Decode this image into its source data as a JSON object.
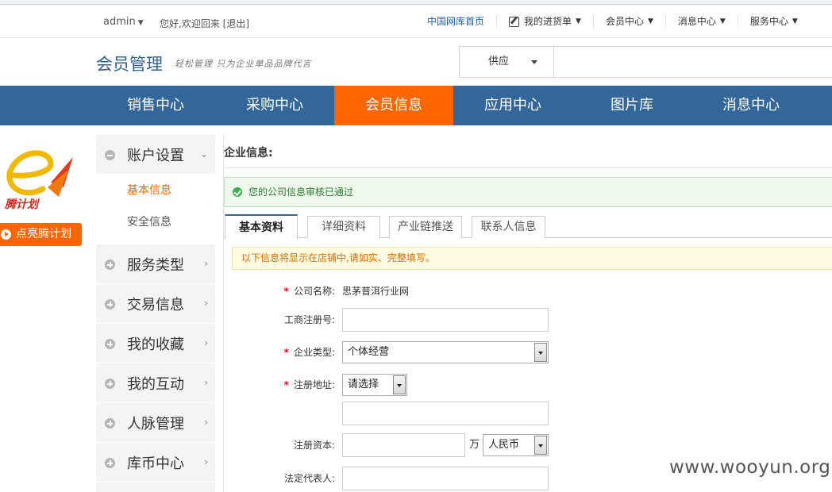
{
  "topbar": {
    "username": "admin",
    "greeting": "您好,欢迎回来",
    "logout": "[退出]",
    "nav": {
      "home": "中国网库首页",
      "purchase_orders": "我的进货单",
      "member_center": "会员中心",
      "message_center": "消息中心",
      "service_center": "服务中心"
    }
  },
  "header": {
    "title": "会员管理",
    "slogan": "轻松管理 只为企业单品品牌代言",
    "search_type": "供应",
    "search_placeholder": ""
  },
  "mainnav": {
    "tabs": [
      "销售中心",
      "采购中心",
      "会员信息",
      "应用中心",
      "图片库",
      "消息中心"
    ],
    "active": "会员信息"
  },
  "promo": {
    "logo_text": "腾计划",
    "button": "点亮腾计划"
  },
  "sidebar": {
    "account": "账户设置",
    "account_subs": [
      "基本信息",
      "安全信息"
    ],
    "groups": [
      "服务类型",
      "交易信息",
      "我的收藏",
      "我的互动",
      "人脉管理",
      "库币中心"
    ]
  },
  "content": {
    "section_title": "企业信息:",
    "notice_ok": "您的公司信息审核已通过",
    "tabs": [
      "基本资料",
      "详细资料",
      "产业链推送",
      "联系人信息"
    ],
    "notice_warn": "以下信息将显示在店铺中,请如实、完整填写。",
    "form": {
      "company_name_label": "公司名称:",
      "company_name_value": "思茅普洱行业网",
      "reg_no_label": "工商注册号:",
      "reg_no_value": "",
      "ent_type_label": "企业类型:",
      "ent_type_value": "个体经营",
      "reg_addr_label": "注册地址:",
      "reg_addr_select": "请选择",
      "reg_addr_detail": "",
      "reg_capital_label": "注册资本:",
      "reg_capital_value": "",
      "reg_capital_unit": "万",
      "currency_value": "人民币",
      "legal_rep_label": "法定代表人:",
      "legal_rep_value": ""
    }
  },
  "watermark": "www.wooyun.org",
  "colors": {
    "nav_blue": "#336699",
    "accent_orange": "#FF6600",
    "ok_green": "#3AB14A",
    "required_red": "#D9001B"
  }
}
